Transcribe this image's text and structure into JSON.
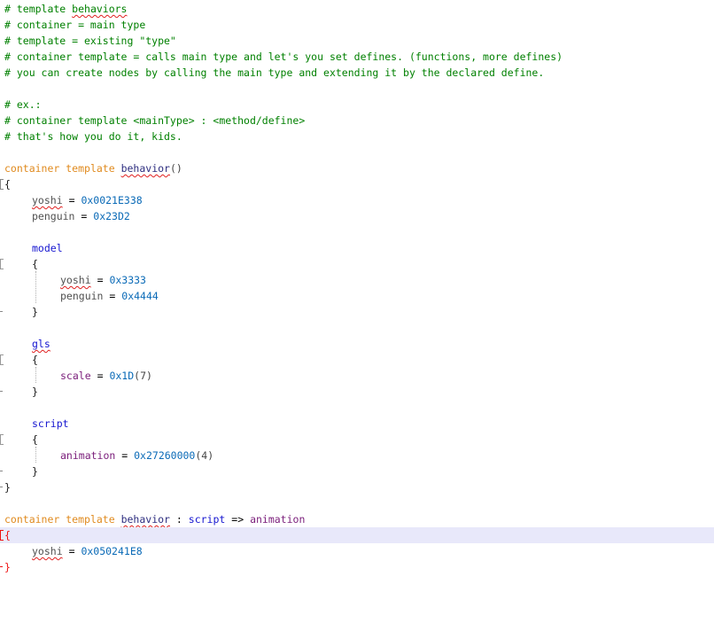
{
  "comments": {
    "c1": "# template behaviors",
    "c2": "# container = main type",
    "c3": "# template = existing \"type\"",
    "c4": "# container template = calls main type and let's you set defines. (functions, more defines)",
    "c5": "# you can create nodes by calling the main type and extending it by the declared define.",
    "c6": "# ex.:",
    "c7": "# container template <mainType> : <method/define>",
    "c8": "# that's how you do it, kids."
  },
  "block1": {
    "kw_container": "container",
    "kw_template": "template",
    "name": "behavior",
    "parens": "()",
    "open_brace": "{",
    "close_brace": "}",
    "yoshi_name": "yoshi",
    "yoshi_value": "0x0021E338",
    "penguin_name": "penguin",
    "penguin_value": "0x23D2",
    "eq": "=",
    "model": {
      "label": "model",
      "open": "{",
      "close": "}",
      "yoshi_name": "yoshi",
      "yoshi_value": "0x3333",
      "penguin_name": "penguin",
      "penguin_value": "0x4444"
    },
    "gls": {
      "label": "gls",
      "open": "{",
      "close": "}",
      "scale_name": "scale",
      "scale_value": "0x1D",
      "scale_arg": "(7)"
    },
    "script": {
      "label": "script",
      "open": "{",
      "close": "}",
      "anim_name": "animation",
      "anim_value": "0x27260000",
      "anim_arg": "(4)"
    }
  },
  "block2": {
    "kw_container": "container",
    "kw_template": "template",
    "name": "behavior",
    "colon": ":",
    "script": "script",
    "arrow": "=>",
    "animation": "animation",
    "open_brace": "{",
    "close_brace": "}",
    "yoshi_name": "yoshi",
    "eq": "=",
    "yoshi_value": "0x050241E8"
  }
}
